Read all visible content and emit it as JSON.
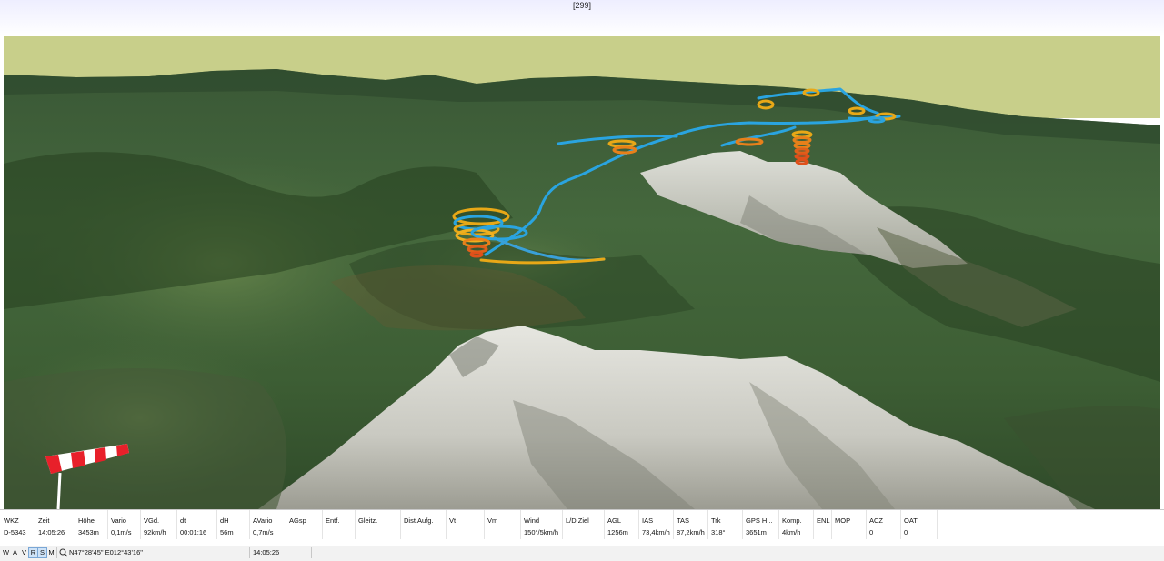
{
  "window": {
    "title": "[299]"
  },
  "colors": {
    "sky": "#c8cf8a",
    "track_climb": "#e8a817",
    "track_glide": "#2aa4e0",
    "track_strong": "#e0501a",
    "windsock_red": "#e8202a"
  },
  "panel": {
    "columns": [
      {
        "label": "WKZ",
        "value": "D-5343"
      },
      {
        "label": "Zeit",
        "value": "14:05:26"
      },
      {
        "label": "Höhe",
        "value": "3453m"
      },
      {
        "label": "Vario",
        "value": "0,1m/s"
      },
      {
        "label": "VGd.",
        "value": "92km/h"
      },
      {
        "label": "dt",
        "value": "00:01:16"
      },
      {
        "label": "dH",
        "value": "56m"
      },
      {
        "label": "AVario",
        "value": "0,7m/s"
      },
      {
        "label": "AGsp",
        "value": ""
      },
      {
        "label": "Entf.",
        "value": ""
      },
      {
        "label": "Gleitz.",
        "value": ""
      },
      {
        "label": "Dist.Aufg.",
        "value": ""
      },
      {
        "label": "Vt",
        "value": ""
      },
      {
        "label": "Vm",
        "value": ""
      },
      {
        "label": "Wind",
        "value": "150°/5km/h"
      },
      {
        "label": "L/D Ziel",
        "value": ""
      },
      {
        "label": "AGL",
        "value": "1256m"
      },
      {
        "label": "IAS",
        "value": "73,4km/h"
      },
      {
        "label": "TAS",
        "value": "87,2km/h"
      },
      {
        "label": "Trk",
        "value": "318°"
      },
      {
        "label": "GPS H...",
        "value": "3651m"
      },
      {
        "label": "Komp.",
        "value": "4km/h"
      },
      {
        "label": "ENL",
        "value": ""
      },
      {
        "label": "MOP",
        "value": ""
      },
      {
        "label": "ACZ",
        "value": "0"
      },
      {
        "label": "OAT",
        "value": "0"
      }
    ]
  },
  "statusbar": {
    "buttons": [
      {
        "label": "W",
        "active": false
      },
      {
        "label": "A",
        "active": false
      },
      {
        "label": "V",
        "active": false
      },
      {
        "label": "R",
        "active": true
      },
      {
        "label": "S",
        "active": true
      },
      {
        "label": "M",
        "active": false
      }
    ],
    "search_icon": "search-icon",
    "coords": "N47°28'45\" E012°43'16\"",
    "time": "14:05:26"
  }
}
